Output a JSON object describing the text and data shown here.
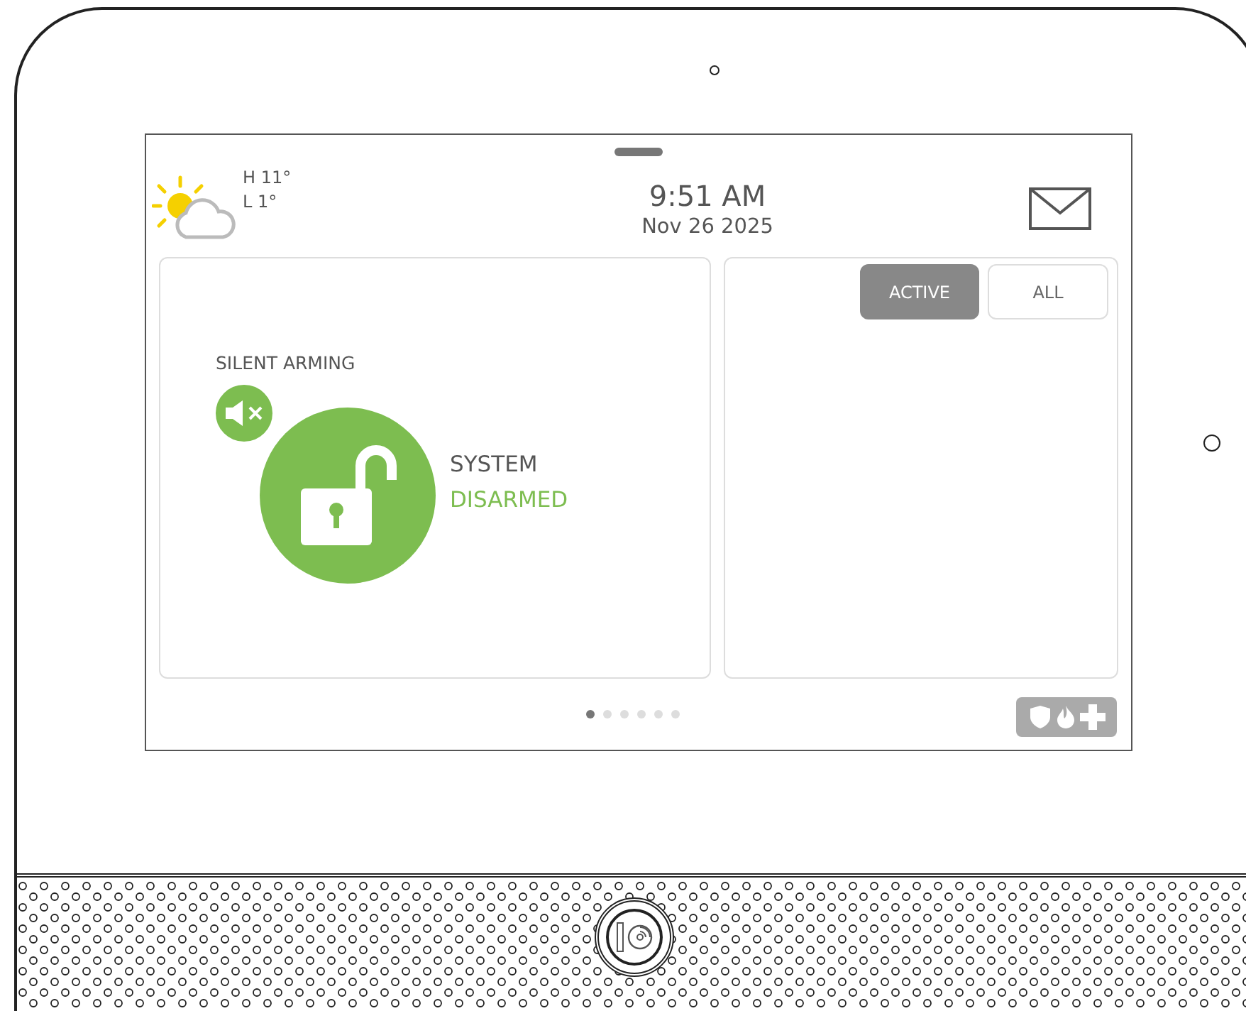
{
  "header": {
    "weather": {
      "high": "H 11°",
      "low": "L 1°"
    },
    "time": "9:51 AM",
    "date": "Nov 26 2025"
  },
  "security": {
    "label": "SILENT ARMING",
    "silent": true,
    "status_line_1": "SYSTEM",
    "status_line_2": "DISARMED",
    "armed": false
  },
  "filters": [
    {
      "label": "ACTIVE",
      "selected": true
    },
    {
      "label": "ALL",
      "selected": false
    }
  ],
  "pages": [
    {
      "selected": true
    },
    {
      "selected": false
    },
    {
      "selected": false
    },
    {
      "selected": false
    },
    {
      "selected": false
    },
    {
      "selected": false
    }
  ]
}
